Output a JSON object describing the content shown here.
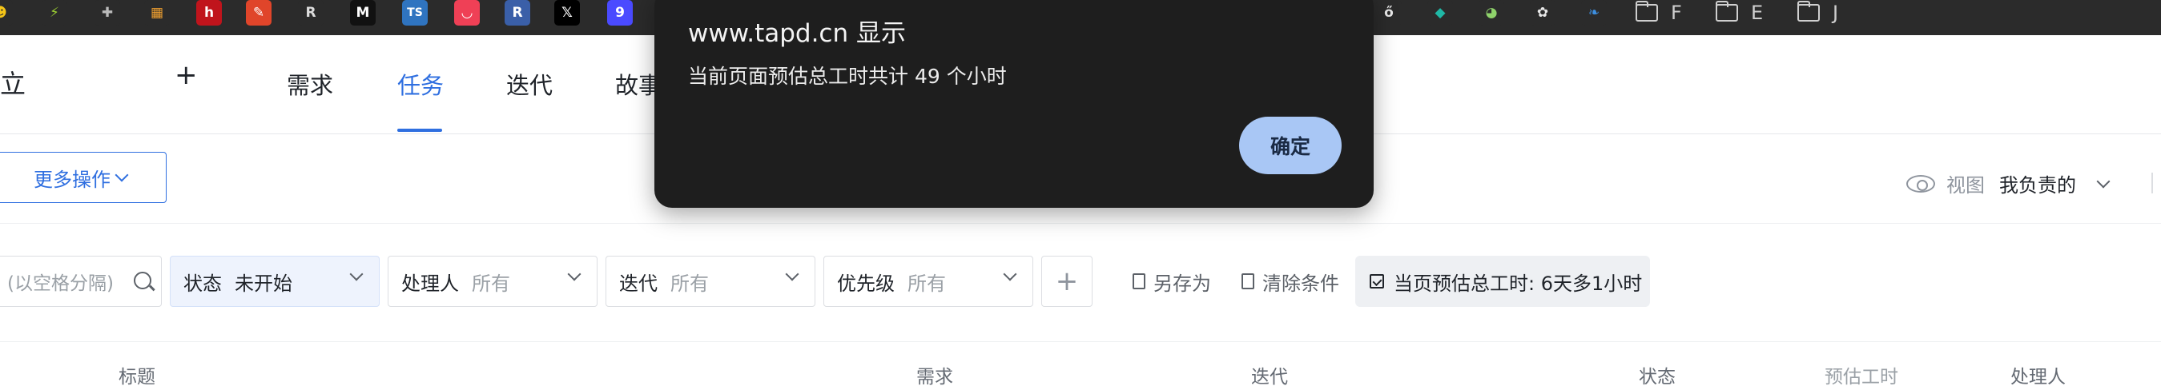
{
  "bookmarks": {
    "icons": [
      {
        "name": "emoji-bookmark-icon",
        "glyph": "☻",
        "bg": "#2b2b2b",
        "fg": "#f5c518"
      },
      {
        "name": "lightning-bookmark-icon",
        "glyph": "⚡",
        "bg": "#2b2b2b",
        "fg": "#9acd32"
      },
      {
        "name": "puzzle-bookmark-icon",
        "glyph": "✚",
        "bg": "#2b2b2b",
        "fg": "#bbbbbb"
      },
      {
        "name": "grid-bookmark-icon",
        "glyph": "▦",
        "bg": "#2b2b2b",
        "fg": "#f0a030"
      },
      {
        "name": "h-bookmark-icon",
        "glyph": "h",
        "bg": "#c0141c",
        "fg": "#ffffff"
      },
      {
        "name": "feather-bookmark-icon",
        "glyph": "✎",
        "bg": "#e0452a",
        "fg": "#ffffff"
      },
      {
        "name": "rust-bookmark-icon",
        "glyph": "R",
        "bg": "#2b2b2b",
        "fg": "#dddddd"
      },
      {
        "name": "m-bookmark-icon",
        "glyph": "M",
        "bg": "#111111",
        "fg": "#ffffff"
      },
      {
        "name": "ts-bookmark-icon",
        "glyph": "TS",
        "bg": "#2f74c0",
        "fg": "#ffffff"
      },
      {
        "name": "pocket-bookmark-icon",
        "glyph": "◡",
        "bg": "#ef4056",
        "fg": "#ffffff"
      },
      {
        "name": "r-bookmark-icon",
        "glyph": "R",
        "bg": "#3a5fa8",
        "fg": "#ffffff"
      },
      {
        "name": "x-bookmark-icon",
        "glyph": "𝕏",
        "bg": "#000000",
        "fg": "#ffffff"
      },
      {
        "name": "g9-bookmark-icon",
        "glyph": "9",
        "bg": "#4a4aff",
        "fg": "#ffffff"
      },
      {
        "name": "ring-bookmark-icon",
        "glyph": "ő",
        "bg": "#2b2b2b",
        "fg": "#e8e8e8"
      },
      {
        "name": "diamond-bookmark-icon",
        "glyph": "◆",
        "bg": "#2b2b2b",
        "fg": "#1fb8a6"
      },
      {
        "name": "pie-bookmark-icon",
        "glyph": "◕",
        "bg": "#2b2b2b",
        "fg": "#8fd36b"
      },
      {
        "name": "openai-bookmark-icon",
        "glyph": "✿",
        "bg": "#2b2b2b",
        "fg": "#e8e8e8"
      },
      {
        "name": "leaf-bookmark-icon",
        "glyph": "❧",
        "bg": "#2b2b2b",
        "fg": "#3d8fe0"
      }
    ],
    "folders": [
      "F",
      "E",
      "J"
    ]
  },
  "nav": {
    "title": "立",
    "plus": "+",
    "tabs": [
      "需求",
      "任务",
      "迭代",
      "故事"
    ],
    "active_tab": 1
  },
  "toolbar": {
    "more_actions": "更多操作",
    "view_label": "视图",
    "view_value": "我负责的"
  },
  "filters": {
    "search_placeholder": "(以空格分隔)",
    "items": [
      {
        "label": "状态",
        "value": "未开始",
        "active": true
      },
      {
        "label": "处理人",
        "value": "所有",
        "active": false
      },
      {
        "label": "迭代",
        "value": "所有",
        "active": false
      },
      {
        "label": "优先级",
        "value": "所有",
        "active": false
      }
    ],
    "add": "+",
    "save_as": "另存为",
    "clear": "清除条件",
    "total_hours": "当页预估总工时: 6天多1小时"
  },
  "table": {
    "headers": [
      "标题",
      "需求",
      "迭代",
      "状态",
      "预估工时",
      "处理人"
    ]
  },
  "dialog": {
    "title": "www.tapd.cn 显示",
    "message": "当前页面预估总工时共计 49 个小时",
    "ok": "确定"
  },
  "colors": {
    "accent": "#2f6fe0",
    "dialog_bg": "#1e1e1e",
    "dialog_button": "#a9c7f5",
    "bookmarks_bar": "#2b2b2b"
  }
}
